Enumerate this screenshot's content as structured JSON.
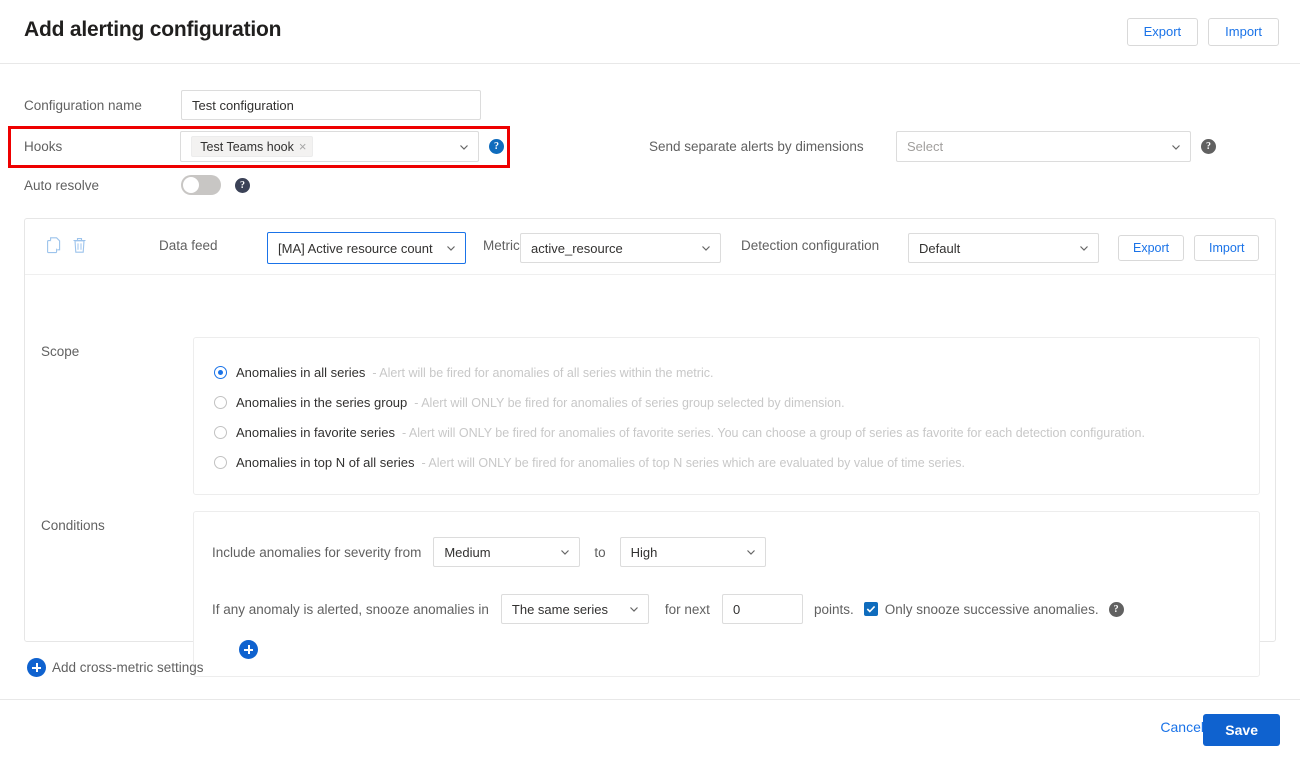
{
  "header": {
    "title": "Add alerting configuration",
    "export_label": "Export",
    "import_label": "Import"
  },
  "form": {
    "configuration_name_label": "Configuration name",
    "configuration_name_value": "Test configuration",
    "hooks_label": "Hooks",
    "hooks_tag": "Test Teams hook",
    "hooks_remove_icon": "×",
    "send_separate_label": "Send separate alerts by dimensions",
    "send_separate_value": "Select",
    "auto_resolve_label": "Auto resolve",
    "auto_resolve_state": "off",
    "help_glyph": "?"
  },
  "metric_card": {
    "copy_icon": "copy-icon",
    "delete_icon": "trash-icon",
    "data_feed_label": "Data feed",
    "data_feed_value": "[MA] Active resource count",
    "metric_label": "Metric",
    "metric_value": "active_resource",
    "detection_config_label": "Detection configuration",
    "detection_config_value": "Default",
    "export_label": "Export",
    "import_label": "Import",
    "scope": {
      "label": "Scope",
      "options": [
        {
          "main": "Anomalies in all series",
          "desc": "- Alert will be fired for anomalies of all series within the metric.",
          "selected": true
        },
        {
          "main": "Anomalies in the series group",
          "desc": "- Alert will ONLY be fired for anomalies of series group selected by dimension.",
          "selected": false
        },
        {
          "main": "Anomalies in favorite series",
          "desc": "- Alert will ONLY be fired for anomalies of favorite series. You can choose a group of series as favorite for each detection configuration.",
          "selected": false
        },
        {
          "main": "Anomalies in top N of all series",
          "desc": "- Alert will ONLY be fired for anomalies of top N series which are evaluated by value of time series.",
          "selected": false
        }
      ]
    },
    "conditions": {
      "label": "Conditions",
      "severity_prefix": "Include anomalies for severity from",
      "severity_from": "Medium",
      "severity_to_label": "to",
      "severity_to": "High",
      "snooze_prefix": "If any anomaly is alerted, snooze anomalies in",
      "snooze_scope": "The same series",
      "for_next_label": "for next",
      "points_value": "0",
      "points_label": "points.",
      "successive_label": "Only snooze successive anomalies.",
      "successive_checked": true,
      "add_condition_icon": "plus-circle-icon"
    }
  },
  "add_cross_metric": {
    "label": "Add cross-metric settings",
    "icon": "plus-circle-icon"
  },
  "footer": {
    "cancel_label": "Cancel",
    "save_label": "Save"
  },
  "annotation": {
    "color": "#ee0000",
    "target": "hooks-row"
  }
}
